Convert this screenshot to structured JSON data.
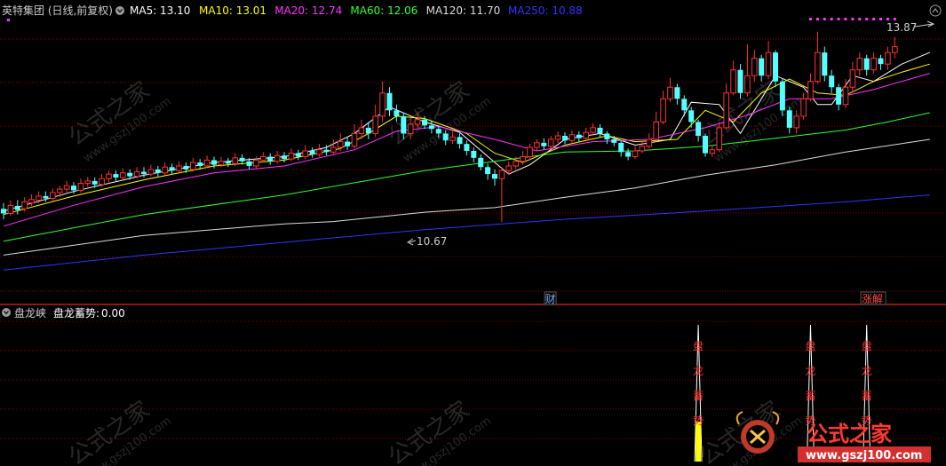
{
  "header": {
    "title": "英特集团 (日线,前复权)",
    "ma": [
      {
        "label": "MA5:",
        "value": "13.10",
        "color": "#ffffff"
      },
      {
        "label": "MA10:",
        "value": "13.01",
        "color": "#ffff00"
      },
      {
        "label": "MA20:",
        "value": "12.74",
        "color": "#ff33ff"
      },
      {
        "label": "MA60:",
        "value": "12.06",
        "color": "#33ff33"
      },
      {
        "label": "MA120:",
        "value": "11.70",
        "color": "#dddddd"
      },
      {
        "label": "MA250:",
        "value": "10.88",
        "color": "#3333ff"
      }
    ]
  },
  "markers": {
    "high": "13.87",
    "low": "10.67",
    "cai": "财",
    "zhangjie": "涨解"
  },
  "indicator": {
    "title": "盘龙峡",
    "label": "盘龙蓄势:",
    "value": "0.00",
    "signal_text": [
      "盘",
      "龙",
      "蓄",
      "势"
    ]
  },
  "watermark": {
    "cn": "公式之家",
    "url": "www.gszj100.com"
  },
  "logo": {
    "cn": "公式之家",
    "url": "www.gszj100.com"
  },
  "chart_data": {
    "type": "candlestick",
    "ylim": [
      9.6,
      14.2
    ],
    "up_color": "#ff3232",
    "down_color": "#54ffff",
    "candles": [
      [
        10.9,
        10.82,
        11.0,
        10.72
      ],
      [
        10.82,
        10.96,
        11.05,
        10.78
      ],
      [
        10.95,
        10.88,
        11.05,
        10.8
      ],
      [
        10.9,
        11.02,
        11.1,
        10.85
      ],
      [
        11.0,
        11.06,
        11.15,
        10.95
      ],
      [
        11.05,
        11.12,
        11.2,
        11.0
      ],
      [
        11.12,
        11.08,
        11.2,
        11.02
      ],
      [
        11.08,
        11.18,
        11.25,
        11.02
      ],
      [
        11.18,
        11.24,
        11.3,
        11.1
      ],
      [
        11.24,
        11.3,
        11.38,
        11.18
      ],
      [
        11.3,
        11.22,
        11.36,
        11.16
      ],
      [
        11.22,
        11.34,
        11.42,
        11.18
      ],
      [
        11.34,
        11.38,
        11.45,
        11.28
      ],
      [
        11.38,
        11.32,
        11.44,
        11.26
      ],
      [
        11.32,
        11.42,
        11.5,
        11.28
      ],
      [
        11.42,
        11.5,
        11.56,
        11.36
      ],
      [
        11.5,
        11.44,
        11.56,
        11.38
      ],
      [
        11.44,
        11.52,
        11.6,
        11.4
      ],
      [
        11.52,
        11.46,
        11.58,
        11.4
      ],
      [
        11.46,
        11.54,
        11.62,
        11.42
      ],
      [
        11.54,
        11.5,
        11.62,
        11.44
      ],
      [
        11.5,
        11.58,
        11.66,
        11.46
      ],
      [
        11.58,
        11.52,
        11.64,
        11.46
      ],
      [
        11.52,
        11.62,
        11.7,
        11.48
      ],
      [
        11.62,
        11.56,
        11.68,
        11.5
      ],
      [
        11.56,
        11.64,
        11.72,
        11.52
      ],
      [
        11.64,
        11.58,
        11.7,
        11.52
      ],
      [
        11.58,
        11.7,
        11.78,
        11.54
      ],
      [
        11.7,
        11.64,
        11.76,
        11.58
      ],
      [
        11.64,
        11.74,
        11.82,
        11.6
      ],
      [
        11.74,
        11.66,
        11.8,
        11.6
      ],
      [
        11.66,
        11.72,
        11.8,
        11.62
      ],
      [
        11.72,
        11.68,
        11.78,
        11.62
      ],
      [
        11.68,
        11.78,
        11.86,
        11.64
      ],
      [
        11.78,
        11.72,
        11.84,
        11.66
      ],
      [
        11.72,
        11.64,
        11.78,
        11.58
      ],
      [
        11.64,
        11.74,
        11.8,
        11.6
      ],
      [
        11.74,
        11.8,
        11.88,
        11.7
      ],
      [
        11.8,
        11.72,
        11.86,
        11.66
      ],
      [
        11.72,
        11.82,
        11.9,
        11.68
      ],
      [
        11.82,
        11.76,
        11.88,
        11.7
      ],
      [
        11.76,
        11.86,
        11.94,
        11.72
      ],
      [
        11.86,
        11.8,
        11.92,
        11.74
      ],
      [
        11.8,
        11.9,
        12.0,
        11.76
      ],
      [
        11.9,
        11.84,
        11.96,
        11.78
      ],
      [
        11.84,
        11.92,
        12.02,
        11.8
      ],
      [
        11.92,
        11.88,
        12.0,
        11.82
      ],
      [
        11.88,
        11.96,
        12.1,
        11.84
      ],
      [
        11.96,
        12.06,
        12.2,
        11.9
      ],
      [
        12.06,
        11.98,
        12.14,
        11.92
      ],
      [
        11.98,
        12.2,
        12.36,
        11.94
      ],
      [
        12.2,
        12.3,
        12.44,
        12.1
      ],
      [
        12.3,
        12.2,
        12.4,
        12.1
      ],
      [
        12.2,
        12.5,
        12.7,
        12.14
      ],
      [
        12.5,
        12.9,
        13.1,
        12.4
      ],
      [
        12.9,
        12.6,
        13.0,
        12.5
      ],
      [
        12.6,
        12.5,
        12.7,
        12.4
      ],
      [
        12.5,
        12.2,
        12.56,
        12.1
      ],
      [
        12.2,
        12.36,
        12.46,
        12.1
      ],
      [
        12.36,
        12.44,
        12.56,
        12.3
      ],
      [
        12.44,
        12.34,
        12.5,
        12.28
      ],
      [
        12.34,
        12.28,
        12.42,
        12.2
      ],
      [
        12.28,
        12.2,
        12.34,
        12.12
      ],
      [
        12.2,
        12.08,
        12.26,
        12.0
      ],
      [
        12.08,
        12.14,
        12.24,
        12.02
      ],
      [
        12.14,
        12.02,
        12.2,
        11.94
      ],
      [
        12.02,
        11.9,
        12.08,
        11.82
      ],
      [
        11.9,
        11.78,
        11.96,
        11.7
      ],
      [
        11.78,
        11.62,
        11.84,
        11.56
      ],
      [
        11.62,
        11.5,
        11.68,
        11.4
      ],
      [
        11.5,
        11.42,
        11.58,
        11.3
      ],
      [
        11.42,
        11.56,
        11.62,
        10.67
      ],
      [
        11.56,
        11.64,
        11.72,
        11.48
      ],
      [
        11.64,
        11.72,
        11.8,
        11.58
      ],
      [
        11.72,
        11.8,
        11.9,
        11.66
      ],
      [
        11.8,
        11.96,
        12.02,
        11.74
      ],
      [
        11.96,
        12.04,
        12.1,
        11.9
      ],
      [
        12.04,
        11.98,
        12.12,
        11.92
      ],
      [
        11.98,
        12.1,
        12.16,
        11.94
      ],
      [
        12.1,
        12.16,
        12.24,
        12.04
      ],
      [
        12.16,
        12.08,
        12.22,
        12.02
      ],
      [
        12.08,
        12.18,
        12.26,
        12.04
      ],
      [
        12.18,
        12.12,
        12.24,
        12.06
      ],
      [
        12.12,
        12.22,
        12.3,
        12.08
      ],
      [
        12.22,
        12.3,
        12.38,
        12.16
      ],
      [
        12.3,
        12.2,
        12.36,
        12.14
      ],
      [
        12.2,
        12.1,
        12.24,
        12.02
      ],
      [
        12.1,
        12.04,
        12.16,
        11.98
      ],
      [
        12.04,
        11.88,
        12.08,
        11.8
      ],
      [
        11.88,
        11.8,
        11.94,
        11.74
      ],
      [
        11.8,
        11.9,
        11.98,
        11.76
      ],
      [
        11.9,
        11.98,
        12.06,
        11.86
      ],
      [
        11.98,
        12.1,
        12.2,
        11.94
      ],
      [
        12.1,
        12.4,
        12.58,
        12.06
      ],
      [
        12.4,
        12.8,
        12.94,
        12.36
      ],
      [
        12.8,
        13.0,
        13.16,
        12.74
      ],
      [
        13.0,
        12.8,
        13.06,
        12.7
      ],
      [
        12.8,
        12.6,
        12.86,
        12.5
      ],
      [
        12.6,
        12.4,
        12.66,
        12.3
      ],
      [
        12.4,
        12.16,
        12.44,
        12.06
      ],
      [
        12.16,
        11.86,
        12.2,
        11.8
      ],
      [
        11.86,
        11.92,
        12.0,
        11.8
      ],
      [
        11.92,
        12.3,
        12.4,
        11.88
      ],
      [
        12.3,
        12.9,
        13.06,
        12.26
      ],
      [
        12.9,
        13.3,
        13.46,
        12.86
      ],
      [
        13.3,
        12.9,
        13.4,
        12.8
      ],
      [
        12.9,
        13.2,
        13.74,
        12.84
      ],
      [
        13.2,
        13.5,
        13.64,
        13.1
      ],
      [
        13.5,
        13.2,
        13.56,
        13.1
      ],
      [
        13.2,
        13.6,
        13.8,
        13.14
      ],
      [
        13.6,
        13.1,
        13.64,
        13.0
      ],
      [
        13.1,
        12.6,
        13.14,
        12.5
      ],
      [
        12.6,
        12.3,
        12.66,
        12.2
      ],
      [
        12.3,
        12.5,
        12.6,
        12.2
      ],
      [
        12.5,
        12.8,
        12.9,
        12.44
      ],
      [
        12.8,
        13.1,
        13.24,
        12.76
      ],
      [
        13.1,
        13.6,
        13.96,
        13.06
      ],
      [
        13.6,
        13.2,
        13.7,
        13.1
      ],
      [
        13.2,
        13.0,
        13.3,
        12.9
      ],
      [
        13.0,
        12.7,
        13.06,
        12.6
      ],
      [
        12.7,
        13.0,
        13.14,
        12.64
      ],
      [
        13.0,
        13.3,
        13.44,
        12.9
      ],
      [
        13.3,
        13.5,
        13.6,
        13.2
      ],
      [
        13.5,
        13.3,
        13.56,
        13.2
      ],
      [
        13.3,
        13.5,
        13.6,
        13.24
      ],
      [
        13.5,
        13.4,
        13.56,
        13.3
      ],
      [
        13.4,
        13.6,
        13.7,
        13.3
      ],
      [
        13.6,
        13.7,
        13.87,
        13.5
      ]
    ],
    "lines": [
      {
        "name": "MA5",
        "color": "#ffffff",
        "pts": [
          [
            0,
            10.86
          ],
          [
            10,
            11.2
          ],
          [
            20,
            11.48
          ],
          [
            30,
            11.7
          ],
          [
            40,
            11.8
          ],
          [
            46,
            11.96
          ],
          [
            50,
            12.2
          ],
          [
            55,
            12.66
          ],
          [
            60,
            12.4
          ],
          [
            65,
            12.22
          ],
          [
            70,
            11.7
          ],
          [
            72,
            11.5
          ],
          [
            75,
            11.66
          ],
          [
            80,
            12.1
          ],
          [
            85,
            12.2
          ],
          [
            90,
            12.0
          ],
          [
            95,
            12.1
          ],
          [
            98,
            12.74
          ],
          [
            102,
            12.7
          ],
          [
            105,
            12.2
          ],
          [
            110,
            13.2
          ],
          [
            114,
            13.0
          ],
          [
            116,
            12.7
          ],
          [
            118,
            12.7
          ],
          [
            121,
            13.2
          ],
          [
            124,
            13.1
          ],
          [
            128,
            13.4
          ],
          [
            130,
            13.5
          ],
          [
            132,
            13.6
          ]
        ]
      },
      {
        "name": "MA10",
        "color": "#ffff00",
        "pts": [
          [
            0,
            10.8
          ],
          [
            10,
            11.12
          ],
          [
            20,
            11.4
          ],
          [
            30,
            11.64
          ],
          [
            40,
            11.74
          ],
          [
            48,
            11.94
          ],
          [
            52,
            12.2
          ],
          [
            56,
            12.5
          ],
          [
            60,
            12.46
          ],
          [
            66,
            12.2
          ],
          [
            70,
            11.86
          ],
          [
            74,
            11.7
          ],
          [
            80,
            12.0
          ],
          [
            86,
            12.16
          ],
          [
            90,
            12.06
          ],
          [
            96,
            12.1
          ],
          [
            100,
            12.6
          ],
          [
            104,
            12.4
          ],
          [
            108,
            12.9
          ],
          [
            112,
            13.14
          ],
          [
            116,
            12.9
          ],
          [
            120,
            12.86
          ],
          [
            124,
            13.1
          ],
          [
            128,
            13.26
          ],
          [
            132,
            13.4
          ]
        ]
      },
      {
        "name": "MA20",
        "color": "#ff33ff",
        "pts": [
          [
            0,
            10.6
          ],
          [
            10,
            10.96
          ],
          [
            20,
            11.28
          ],
          [
            30,
            11.52
          ],
          [
            40,
            11.64
          ],
          [
            50,
            11.92
          ],
          [
            56,
            12.24
          ],
          [
            62,
            12.32
          ],
          [
            70,
            12.1
          ],
          [
            76,
            11.9
          ],
          [
            84,
            12.06
          ],
          [
            92,
            12.1
          ],
          [
            100,
            12.3
          ],
          [
            106,
            12.52
          ],
          [
            112,
            12.8
          ],
          [
            118,
            12.8
          ],
          [
            124,
            12.96
          ],
          [
            128,
            13.1
          ],
          [
            132,
            13.24
          ]
        ]
      },
      {
        "name": "MA60",
        "color": "#33ff33",
        "pts": [
          [
            0,
            10.34
          ],
          [
            20,
            10.8
          ],
          [
            40,
            11.14
          ],
          [
            60,
            11.56
          ],
          [
            70,
            11.72
          ],
          [
            80,
            11.88
          ],
          [
            90,
            11.9
          ],
          [
            100,
            11.98
          ],
          [
            110,
            12.12
          ],
          [
            120,
            12.26
          ],
          [
            126,
            12.4
          ],
          [
            132,
            12.56
          ]
        ]
      },
      {
        "name": "MA120",
        "color": "#dddddd",
        "pts": [
          [
            0,
            10.1
          ],
          [
            20,
            10.44
          ],
          [
            40,
            10.64
          ],
          [
            47,
            10.68
          ],
          [
            60,
            10.84
          ],
          [
            70,
            10.92
          ],
          [
            80,
            11.1
          ],
          [
            90,
            11.26
          ],
          [
            100,
            11.48
          ],
          [
            110,
            11.66
          ],
          [
            120,
            11.88
          ],
          [
            132,
            12.1
          ]
        ]
      },
      {
        "name": "MA250",
        "color": "#3333ff",
        "pts": [
          [
            0,
            9.84
          ],
          [
            20,
            10.1
          ],
          [
            40,
            10.32
          ],
          [
            60,
            10.54
          ],
          [
            80,
            10.72
          ],
          [
            100,
            10.86
          ],
          [
            120,
            11.02
          ],
          [
            132,
            11.14
          ]
        ]
      }
    ],
    "indicator_signals": [
      {
        "index": 99,
        "level": 1.0
      },
      {
        "index": 115,
        "level": 1.0
      },
      {
        "index": 123,
        "level": 1.0
      }
    ]
  }
}
